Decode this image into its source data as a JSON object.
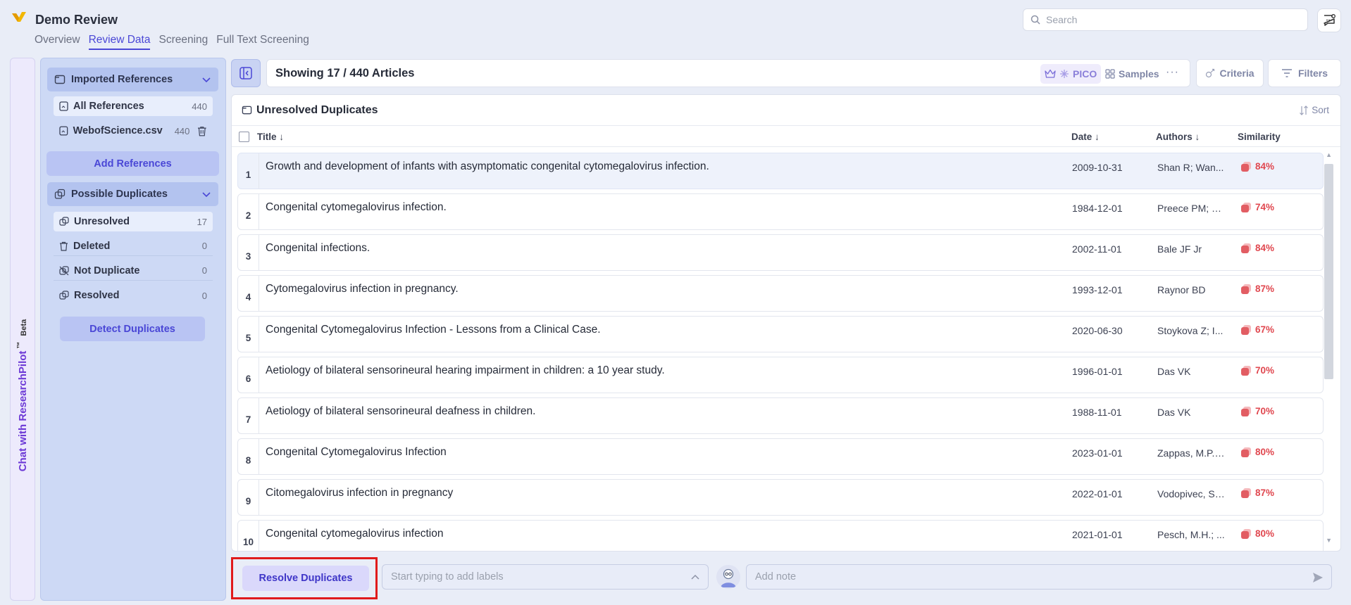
{
  "app": {
    "title": "Demo Review",
    "tabs": [
      {
        "label": "Overview",
        "active": false
      },
      {
        "label": "Review Data",
        "active": true
      },
      {
        "label": "Screening",
        "active": false
      },
      {
        "label": "Full Text Screening",
        "active": false
      }
    ],
    "search_placeholder": "Search"
  },
  "chat_rail": {
    "label": "Chat with ResearchPilot",
    "tm": "™",
    "beta": "Beta"
  },
  "sidebar": {
    "imported": {
      "title": "Imported References",
      "items": [
        {
          "label": "All References",
          "count": "440"
        },
        {
          "label": "WebofScience.csv",
          "count": "440"
        }
      ],
      "add_button": "Add References"
    },
    "duplicates": {
      "title": "Possible Duplicates",
      "items": [
        {
          "label": "Unresolved",
          "count": "17"
        },
        {
          "label": "Deleted",
          "count": "0"
        },
        {
          "label": "Not Duplicate",
          "count": "0"
        },
        {
          "label": "Resolved",
          "count": "0"
        }
      ],
      "detect_button": "Detect Duplicates"
    }
  },
  "toolbar": {
    "showing": "Showing 17 / 440 Articles",
    "pico": "PICO",
    "samples": "Samples",
    "more": "···",
    "criteria": "Criteria",
    "filters": "Filters"
  },
  "panel": {
    "title": "Unresolved Duplicates",
    "sort": "Sort",
    "columns": {
      "title": "Title",
      "date": "Date",
      "authors": "Authors",
      "similarity": "Similarity"
    },
    "rows": [
      {
        "num": "1",
        "title": "Growth and development of infants with asymptomatic congenital cytomegalovirus infection.",
        "date": "2009-10-31",
        "authors": "Shan R; Wan...",
        "similarity": "84%"
      },
      {
        "num": "2",
        "title": "Congenital cytomegalovirus infection.",
        "date": "1984-12-01",
        "authors": "Preece PM; P...",
        "similarity": "74%"
      },
      {
        "num": "3",
        "title": "Congenital infections.",
        "date": "2002-11-01",
        "authors": "Bale JF Jr",
        "similarity": "84%"
      },
      {
        "num": "4",
        "title": "Cytomegalovirus infection in pregnancy.",
        "date": "1993-12-01",
        "authors": "Raynor BD",
        "similarity": "87%"
      },
      {
        "num": "5",
        "title": "Congenital Cytomegalovirus Infection - Lessons from a Clinical Case.",
        "date": "2020-06-30",
        "authors": "Stoykova Z; I...",
        "similarity": "67%"
      },
      {
        "num": "6",
        "title": "Aetiology of bilateral sensorineural hearing impairment in children: a 10 year study.",
        "date": "1996-01-01",
        "authors": "Das VK",
        "similarity": "70%"
      },
      {
        "num": "7",
        "title": "Aetiology of bilateral sensorineural deafness in children.",
        "date": "1988-11-01",
        "authors": "Das VK",
        "similarity": "70%"
      },
      {
        "num": "8",
        "title": "Congenital Cytomegalovirus Infection",
        "date": "2023-01-01",
        "authors": "Zappas, M.P.;...",
        "similarity": "80%"
      },
      {
        "num": "9",
        "title": "Citomegalovirus infection in pregnancy",
        "date": "2022-01-01",
        "authors": "Vodopivec, S....",
        "similarity": "87%"
      },
      {
        "num": "10",
        "title": "Congenital cytomegalovirus infection",
        "date": "2021-01-01",
        "authors": "Pesch, M.H.; ...",
        "similarity": "80%"
      }
    ]
  },
  "bottom": {
    "resolve_button": "Resolve Duplicates",
    "labels_placeholder": "Start typing to add labels",
    "note_placeholder": "Add note"
  },
  "colors": {
    "accent": "#4a47d6",
    "similarity": "#e0474f",
    "highlight": "#e01b1b"
  }
}
